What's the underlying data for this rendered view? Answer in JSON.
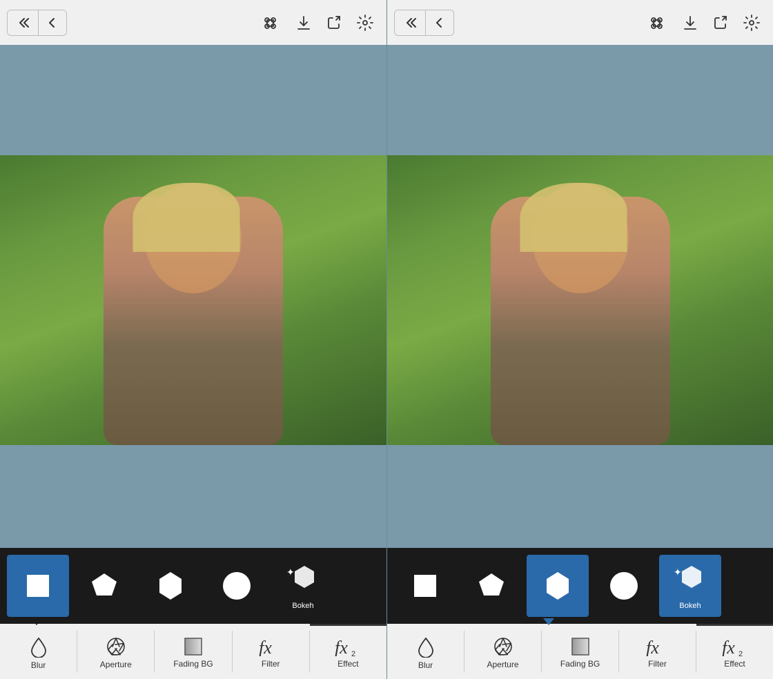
{
  "panels": [
    {
      "id": "panel-left",
      "toolbar": {
        "back_double_label": "«",
        "back_single_label": "‹",
        "video_icon": "video",
        "download_icon": "download",
        "share_icon": "share",
        "settings_icon": "settings"
      },
      "shapes": [
        {
          "id": "square",
          "label": "",
          "active": true
        },
        {
          "id": "pentagon",
          "label": "",
          "active": false
        },
        {
          "id": "hexagon",
          "label": "",
          "active": false
        },
        {
          "id": "circle",
          "label": "",
          "active": false
        },
        {
          "id": "bokeh",
          "label": "Bokeh",
          "active": false
        }
      ],
      "active_shape_indicator": "square",
      "tabs": [
        {
          "id": "blur",
          "label": "Blur",
          "icon": "drop",
          "active": false
        },
        {
          "id": "aperture",
          "label": "Aperture",
          "icon": "aperture",
          "active": false
        },
        {
          "id": "fading-bg",
          "label": "Fading BG",
          "icon": "square",
          "active": false
        },
        {
          "id": "filter",
          "label": "Filter",
          "icon": "fx",
          "active": false
        },
        {
          "id": "effect",
          "label": "Effect",
          "icon": "fx2",
          "active": true
        }
      ]
    },
    {
      "id": "panel-right",
      "toolbar": {
        "back_double_label": "«",
        "back_single_label": "‹",
        "video_icon": "video",
        "download_icon": "download",
        "share_icon": "share",
        "settings_icon": "settings"
      },
      "shapes": [
        {
          "id": "square",
          "label": "",
          "active": false
        },
        {
          "id": "pentagon",
          "label": "",
          "active": false
        },
        {
          "id": "hexagon",
          "label": "",
          "active": true
        },
        {
          "id": "circle",
          "label": "",
          "active": false
        },
        {
          "id": "bokeh",
          "label": "Bokeh",
          "active": true
        }
      ],
      "active_shape_indicator": "hexagon",
      "tabs": [
        {
          "id": "blur",
          "label": "Blur",
          "icon": "drop",
          "active": false
        },
        {
          "id": "aperture",
          "label": "Aperture",
          "icon": "aperture",
          "active": false
        },
        {
          "id": "fading-bg",
          "label": "Fading BG",
          "icon": "square",
          "active": false
        },
        {
          "id": "filter",
          "label": "Filter",
          "icon": "fx",
          "active": false
        },
        {
          "id": "effect",
          "label": "Effect",
          "icon": "fx2",
          "active": true
        }
      ]
    }
  ]
}
